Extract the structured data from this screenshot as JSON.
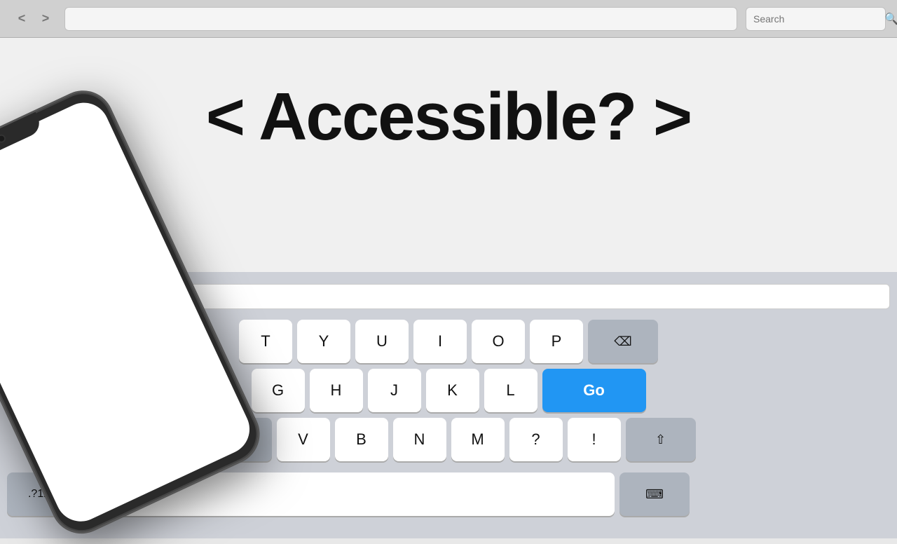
{
  "browser": {
    "back_label": "<",
    "forward_label": ">",
    "url_placeholder": "",
    "search_placeholder": "Search"
  },
  "heading": {
    "text": "< Accessible? >"
  },
  "keyboard": {
    "row1": [
      "T",
      "Y",
      "U",
      "I",
      "O",
      "P"
    ],
    "row2": [
      "G",
      "H",
      "J",
      "K",
      "L"
    ],
    "row3": [
      "V",
      "B",
      "N",
      "M",
      "?",
      "!"
    ],
    "go_label": "Go",
    "num_label": ".?123",
    "delete_label": "⌫",
    "shift_label": "⇧",
    "keyboard_label": "⌨"
  },
  "colors": {
    "go_button": "#2196f3",
    "keyboard_bg": "#ced1d8",
    "key_bg": "#ffffff",
    "special_key_bg": "#adb4be"
  }
}
